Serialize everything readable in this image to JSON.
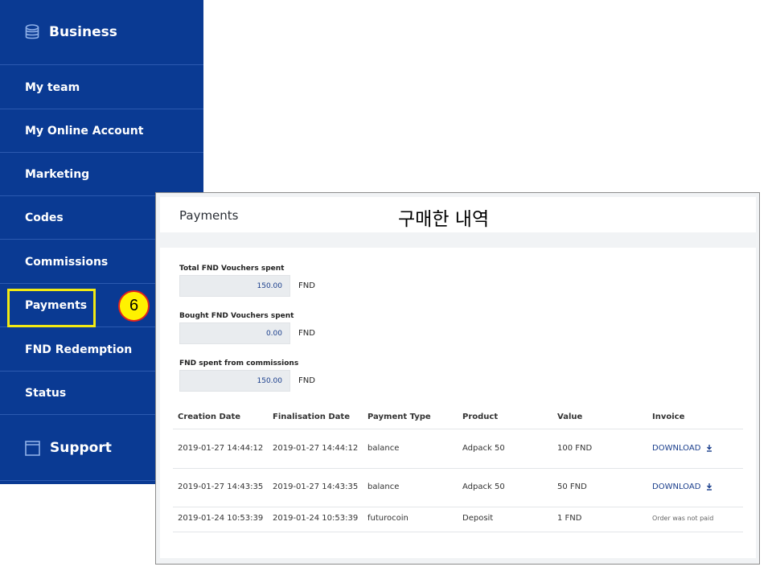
{
  "sidebar": {
    "section_title": "Business",
    "section_icon": "database-icon",
    "items": [
      {
        "label": "My team"
      },
      {
        "label": "My Online Account"
      },
      {
        "label": "Marketing"
      },
      {
        "label": "Codes"
      },
      {
        "label": "Commissions"
      },
      {
        "label": "Payments"
      },
      {
        "label": "FND Redemption"
      },
      {
        "label": "Status"
      }
    ],
    "support_title": "Support",
    "support_icon": "window-icon"
  },
  "annotation": {
    "step_number": "6",
    "korean_note": "구매한 내역",
    "highlight_color": "#f2ea13",
    "badge_fill": "#fff200",
    "badge_border": "#e02020"
  },
  "panel": {
    "title": "Payments",
    "summary": [
      {
        "label": "Total FND Vouchers spent",
        "value": "150.00",
        "unit": "FND"
      },
      {
        "label": "Bought FND Vouchers spent",
        "value": "0.00",
        "unit": "FND"
      },
      {
        "label": "FND spent from commissions",
        "value": "150.00",
        "unit": "FND"
      }
    ],
    "table": {
      "columns": [
        "Creation Date",
        "Finalisation Date",
        "Payment Type",
        "Product",
        "Value",
        "Invoice"
      ],
      "rows": [
        {
          "creation": "2019-01-27 14:44:12",
          "finalisation": "2019-01-27 14:44:12",
          "type": "balance",
          "product": "Adpack 50",
          "value": "100 FND",
          "invoice": "DOWNLOAD"
        },
        {
          "creation": "2019-01-27 14:43:35",
          "finalisation": "2019-01-27 14:43:35",
          "type": "balance",
          "product": "Adpack 50",
          "value": "50 FND",
          "invoice": "DOWNLOAD"
        },
        {
          "creation": "2019-01-24 10:53:39",
          "finalisation": "2019-01-24 10:53:39",
          "type": "futurocoin",
          "product": "Deposit",
          "value": "1 FND",
          "invoice": "Order was not paid"
        }
      ]
    }
  },
  "colors": {
    "sidebar_bg": "#0a3a93",
    "link_blue": "#1a3e8c"
  }
}
